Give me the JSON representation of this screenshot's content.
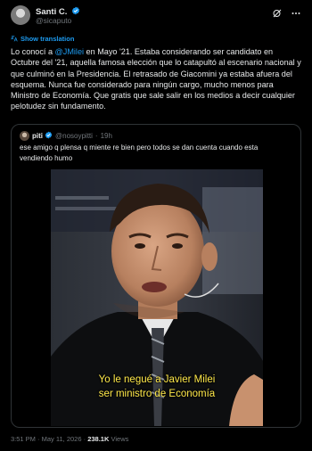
{
  "author": {
    "name": "Santi C.",
    "handle": "@sicaputo"
  },
  "translation_link": "Show translation",
  "tweet": {
    "text_before": "Lo conocí a ",
    "mention": "@JMilei",
    "text_after": " en Mayo '21. Estaba considerando ser candidato en Octubre del '21, aquella famosa elección que lo catapultó al escenario nacional y que culminó en la Presidencia. El retrasado de Giacomini ya estaba afuera del esquema. Nunca fue considerado para ningún cargo, mucho menos para Ministro de Economía. Que gratis que sale salir en los medios a decir cualquier pelotudez sin fundamento."
  },
  "quote": {
    "name": "piti",
    "handle": "@nosoypitti",
    "separator": "·",
    "time": "19h",
    "text": "ese amigo q plensa q miente re bien pero todos se dan cuenta cuando esta vendiendo humo",
    "video": {
      "subtitle_line1": "Yo le negué a Javier Milei",
      "subtitle_line2": "ser ministro de Economía"
    }
  },
  "footer": {
    "time": "3:51 PM",
    "date": "May 11, 2026",
    "views_count": "238.1K",
    "views_label": "Views",
    "sep": "·"
  },
  "icons": [
    "verified-badge-icon",
    "grok-icon",
    "more-icon",
    "translate-icon"
  ],
  "colors": {
    "accent": "#1d9bf0",
    "text": "#e7e9ea",
    "muted": "#71767b",
    "border": "#2f3336",
    "subtitle": "#ffe94a"
  }
}
